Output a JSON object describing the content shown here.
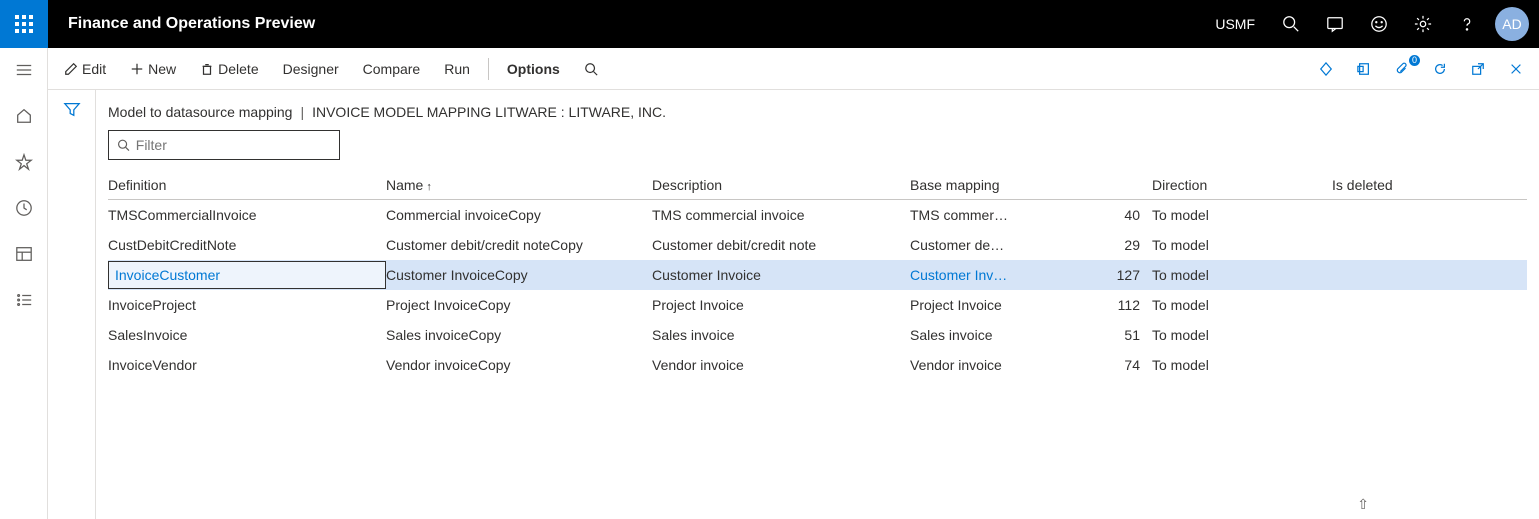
{
  "header": {
    "app_title": "Finance and Operations Preview",
    "entity": "USMF",
    "avatar": "AD"
  },
  "commands": {
    "edit": "Edit",
    "new": "New",
    "delete": "Delete",
    "designer": "Designer",
    "compare": "Compare",
    "run": "Run",
    "options": "Options",
    "attach_badge": "0"
  },
  "breadcrumb": {
    "page": "Model to datasource mapping",
    "context": "INVOICE MODEL MAPPING LITWARE : LITWARE, INC."
  },
  "filter": {
    "placeholder": "Filter",
    "value": ""
  },
  "grid": {
    "columns": {
      "definition": "Definition",
      "name": "Name",
      "description": "Description",
      "base_mapping": "Base mapping",
      "count": "",
      "direction": "Direction",
      "is_deleted": "Is deleted"
    },
    "sort_arrow": "↑",
    "rows": [
      {
        "definition": "TMSCommercialInvoice",
        "name": "Commercial invoiceCopy",
        "description": "TMS commercial invoice",
        "base_mapping": "TMS commer…",
        "count": "40",
        "direction": "To model",
        "is_deleted": "",
        "selected": false
      },
      {
        "definition": "CustDebitCreditNote",
        "name": "Customer debit/credit noteCopy",
        "description": "Customer debit/credit note",
        "base_mapping": "Customer de…",
        "count": "29",
        "direction": "To model",
        "is_deleted": "",
        "selected": false
      },
      {
        "definition": "InvoiceCustomer",
        "name": "Customer InvoiceCopy",
        "description": "Customer Invoice",
        "base_mapping": "Customer Inv…",
        "count": "127",
        "direction": "To model",
        "is_deleted": "",
        "selected": true
      },
      {
        "definition": "InvoiceProject",
        "name": "Project InvoiceCopy",
        "description": "Project Invoice",
        "base_mapping": "Project Invoice",
        "count": "112",
        "direction": "To model",
        "is_deleted": "",
        "selected": false
      },
      {
        "definition": "SalesInvoice",
        "name": "Sales invoiceCopy",
        "description": "Sales invoice",
        "base_mapping": "Sales invoice",
        "count": "51",
        "direction": "To model",
        "is_deleted": "",
        "selected": false
      },
      {
        "definition": "InvoiceVendor",
        "name": "Vendor invoiceCopy",
        "description": "Vendor invoice",
        "base_mapping": "Vendor invoice",
        "count": "74",
        "direction": "To model",
        "is_deleted": "",
        "selected": false
      }
    ]
  }
}
